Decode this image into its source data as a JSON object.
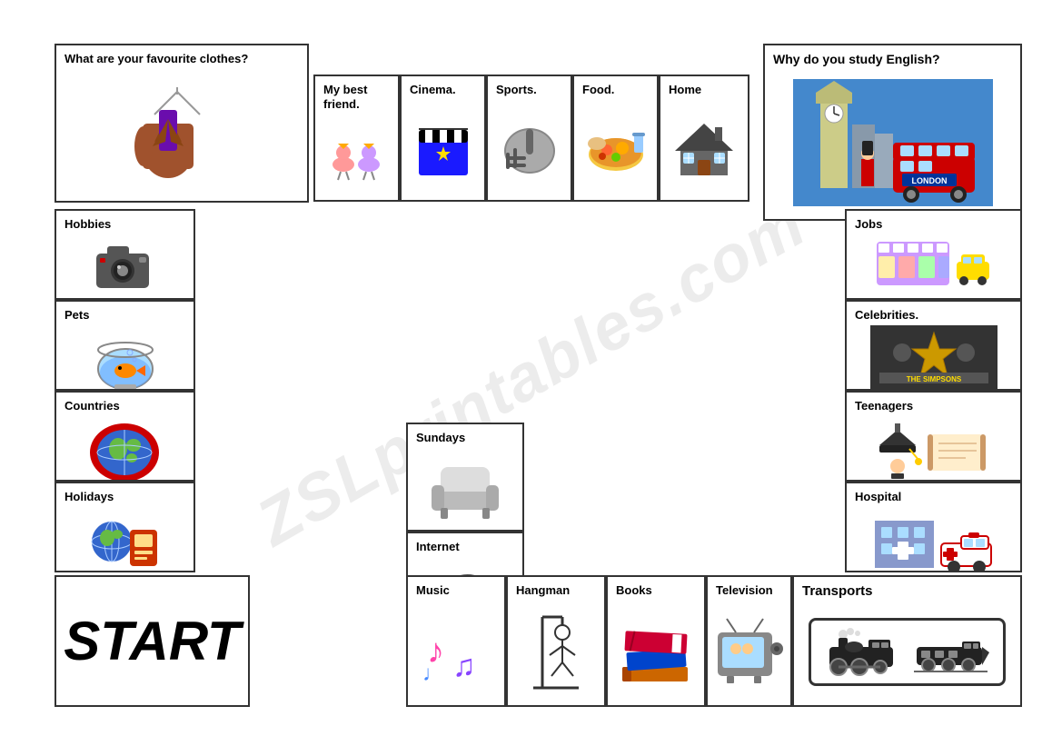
{
  "watermark": "ZSLprintables.com",
  "cells": {
    "clothes": {
      "title": "What are your favourite clothes?",
      "icon": "clothes"
    },
    "bestFriend": {
      "title": "My best friend.",
      "icon": "bestfriend"
    },
    "cinema": {
      "title": "Cinema.",
      "icon": "cinema"
    },
    "sports": {
      "title": "Sports.",
      "icon": "sports"
    },
    "food": {
      "title": "Food.",
      "icon": "food"
    },
    "home": {
      "title": "Home",
      "icon": "home"
    },
    "whyEnglish": {
      "title": "Why do you study English?",
      "icon": "london"
    },
    "hobbies": {
      "title": "Hobbies",
      "icon": "hobbies"
    },
    "pets": {
      "title": "Pets",
      "icon": "pets"
    },
    "countries": {
      "title": "Countries",
      "icon": "countries"
    },
    "holidays": {
      "title": "Holidays",
      "icon": "holidays"
    },
    "start": {
      "title": "START"
    },
    "sundays": {
      "title": "Sundays",
      "icon": "sundays"
    },
    "internet": {
      "title": "Internet",
      "icon": "internet"
    },
    "music": {
      "title": "Music",
      "icon": "music"
    },
    "hangman": {
      "title": "Hangman",
      "icon": "hangman"
    },
    "books": {
      "title": "Books",
      "icon": "books"
    },
    "television": {
      "title": "Television",
      "icon": "television"
    },
    "transports": {
      "title": "Transports",
      "icon": "transports"
    },
    "jobs": {
      "title": "Jobs",
      "icon": "jobs"
    },
    "celebrities": {
      "title": "Celebrities.",
      "icon": "celebrities"
    },
    "teenagers": {
      "title": "Teenagers",
      "icon": "teenagers"
    },
    "hospital": {
      "title": "Hospital",
      "icon": "hospital"
    }
  }
}
